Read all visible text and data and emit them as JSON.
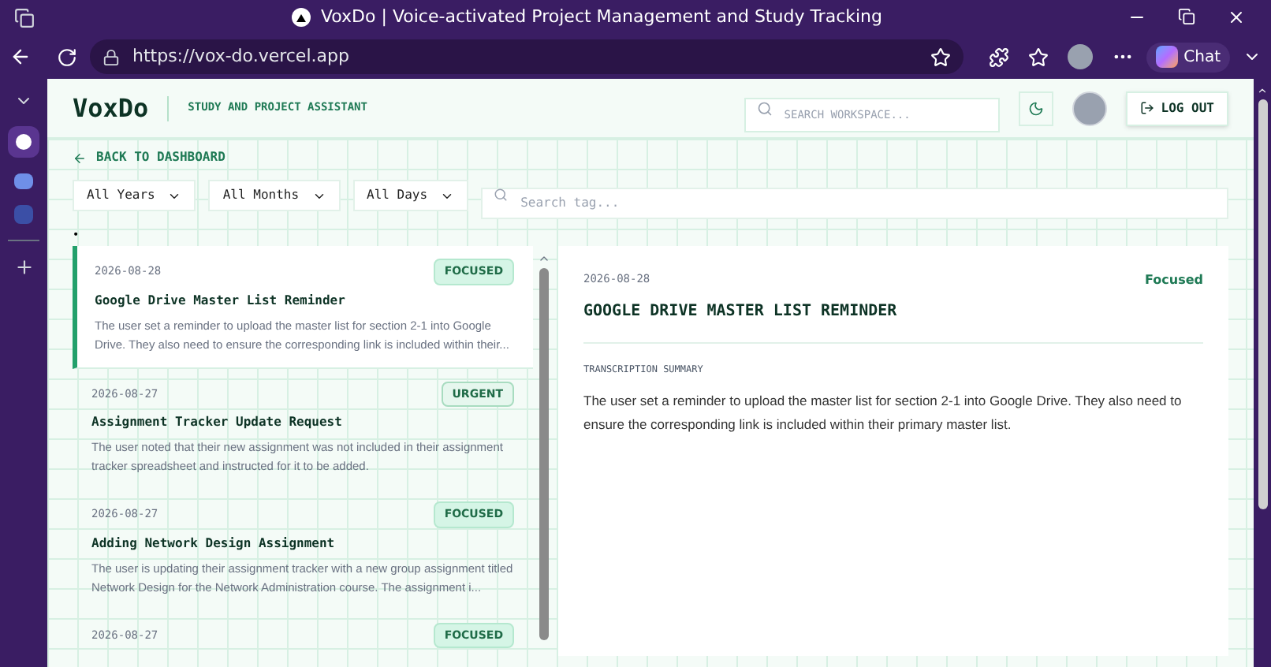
{
  "browser": {
    "title": "VoxDo | Voice-activated Project Management and Study Tracking",
    "url": "https://vox-do.vercel.app",
    "chat_label": "Chat"
  },
  "header": {
    "logo": "VoxDo",
    "tagline": "STUDY AND PROJECT ASSISTANT",
    "search_placeholder": "SEARCH WORKSPACE...",
    "logout": "LOG OUT"
  },
  "back_link": "BACK TO DASHBOARD",
  "filters": [
    {
      "label": "All Years"
    },
    {
      "label": "All Months"
    },
    {
      "label": "All Days"
    }
  ],
  "tag_search_placeholder": "Search tag...",
  "dot": "•",
  "entries": [
    {
      "date": "2026-08-28",
      "badge": "FOCUSED",
      "kind": "focused",
      "title": "Google Drive Master List Reminder",
      "summary": "The user set a reminder to upload the master list for section 2-1 into Google Drive. They also need to ensure the corresponding link is included within their...",
      "selected": true
    },
    {
      "date": "2026-08-27",
      "badge": "URGENT",
      "kind": "urgent",
      "title": "Assignment Tracker Update Request",
      "summary": "The user noted that their new assignment was not included in their assignment tracker spreadsheet and instructed for it to be added.",
      "selected": false
    },
    {
      "date": "2026-08-27",
      "badge": "FOCUSED",
      "kind": "focused",
      "title": "Adding Network Design Assignment",
      "summary": "The user is updating their assignment tracker with a new group assignment titled Network Design for the Network Administration course. The assignment i...",
      "selected": false
    },
    {
      "date": "2026-08-27",
      "badge": "FOCUSED",
      "kind": "focused",
      "selected": false
    }
  ],
  "detail": {
    "date": "2026-08-28",
    "status": "Focused",
    "title": "GOOGLE DRIVE MASTER LIST REMINDER",
    "section_label": "TRANSCRIPTION SUMMARY",
    "summary": "The user set a reminder to upload the master list for section 2-1 into Google Drive. They also need to ensure the corresponding link is included within their primary master list."
  }
}
